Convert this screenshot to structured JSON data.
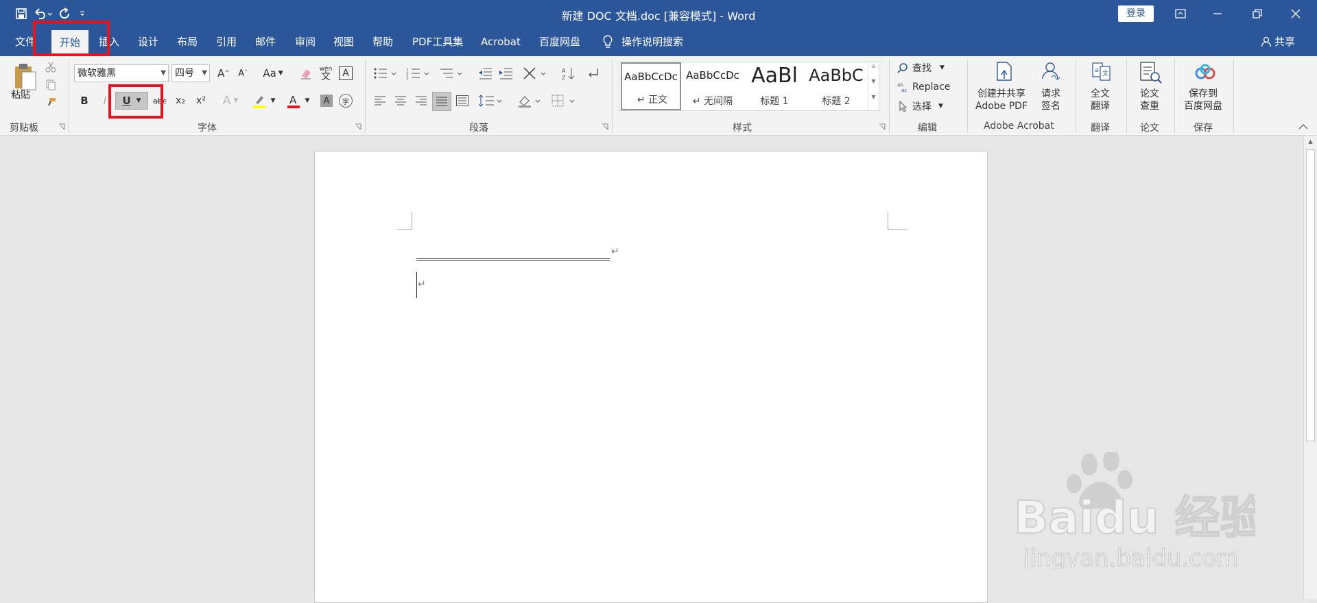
{
  "window": {
    "title": "新建 DOC 文档.doc [兼容模式]  -  Word",
    "login_label": "登录"
  },
  "quick_access": {
    "icons": [
      "save-icon",
      "undo-icon",
      "redo-icon",
      "customize-icon"
    ]
  },
  "menu": {
    "tabs": [
      "文件",
      "开始",
      "插入",
      "设计",
      "布局",
      "引用",
      "邮件",
      "审阅",
      "视图",
      "帮助",
      "PDF工具集",
      "Acrobat",
      "百度网盘"
    ],
    "active": "开始",
    "tell_me": "操作说明搜索",
    "share": "共享"
  },
  "ribbon": {
    "clipboard": {
      "paste": "粘贴",
      "label": "剪贴板"
    },
    "font": {
      "name": "微软雅黑",
      "size": "四号",
      "label": "字体",
      "bold": "B",
      "italic": "I",
      "underline": "U",
      "strike": "abc",
      "subscript": "x₂",
      "superscript": "x²",
      "grow": "A",
      "shrink": "A",
      "case": "Aa",
      "phonetic": "wén",
      "phonetic_char": "文",
      "border_char": "A",
      "effects": "A",
      "shading": "A",
      "enclose": "字",
      "highlight_color": "#ffff00",
      "font_color": "#e8131c"
    },
    "paragraph": {
      "label": "段落"
    },
    "styles": {
      "label": "样式",
      "items": [
        {
          "sample": "AaBbCcDc",
          "name": "↵ 正文"
        },
        {
          "sample": "AaBbCcDc",
          "name": "↵ 无间隔"
        },
        {
          "sample": "AaBl",
          "name": "标题 1"
        },
        {
          "sample": "AaBbC",
          "name": "标题 2"
        }
      ]
    },
    "editing": {
      "find": "查找",
      "replace": "Replace",
      "select": "选择",
      "label": "编辑"
    },
    "acrobat": {
      "create_line1": "创建并共享",
      "create_line2": "Adobe PDF",
      "sign_line1": "请求",
      "sign_line2": "签名",
      "label": "Adobe Acrobat"
    },
    "translate": {
      "line1": "全文",
      "line2": "翻译",
      "label": "翻译"
    },
    "paper": {
      "line1": "论文",
      "line2": "查重",
      "label": "论文"
    },
    "save": {
      "line1": "保存到",
      "line2": "百度网盘",
      "label": "保存"
    }
  },
  "watermark": {
    "brand": "Baidu 经验",
    "url": "jingyan.baidu.com"
  }
}
